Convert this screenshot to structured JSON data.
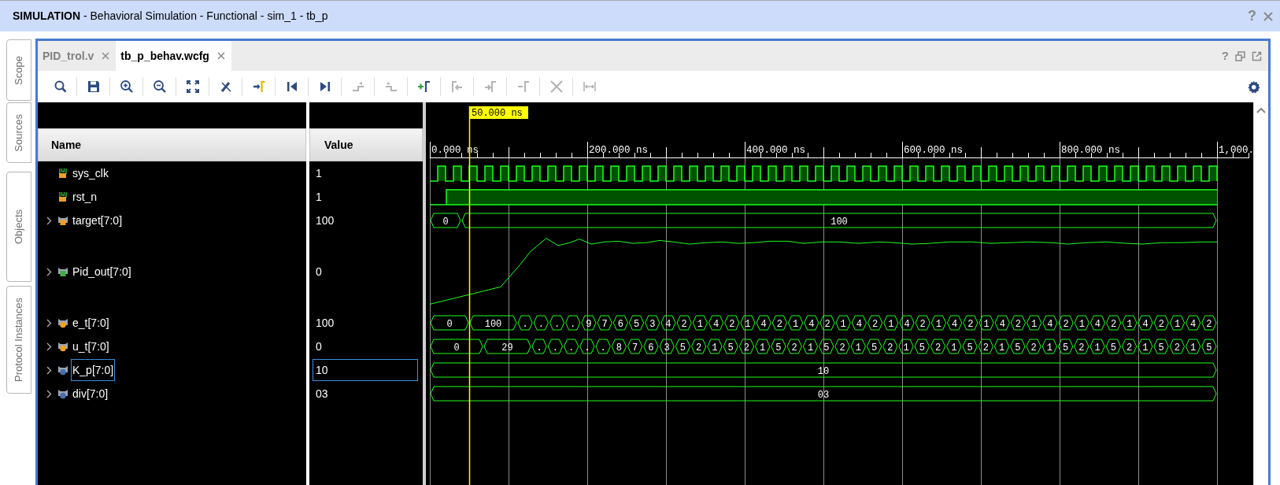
{
  "window": {
    "title": "**SIMULATION** - Behavioral Simulation - Functional - sim_1 - tb_p",
    "help": "?"
  },
  "side_tabs": [
    "Scope",
    "Sources",
    "Objects",
    "Protocol Instances"
  ],
  "tabs": [
    {
      "label": "PID_trol.v",
      "selected": false
    },
    {
      "label": "tb_p_behav.wcfg",
      "selected": true
    }
  ],
  "panel_help": "?",
  "toolbar": [
    {
      "disabled": false
    },
    {
      "disabled": false
    },
    {
      "disabled": false
    },
    {
      "disabled": false
    },
    {
      "disabled": false
    },
    {
      "disabled": false
    },
    {
      "disabled": false
    },
    {
      "disabled": false
    },
    {
      "disabled": false
    },
    {
      "disabled": true
    },
    {
      "disabled": true
    },
    {
      "disabled": false
    },
    {
      "disabled": true
    },
    {
      "disabled": true
    },
    {
      "disabled": true
    },
    {
      "disabled": true
    },
    {
      "disabled": true
    }
  ],
  "columns": [
    "Name",
    "Value"
  ],
  "signals": [
    {
      "name": "sys_clk",
      "value": "1",
      "kind": "clock",
      "selected": false
    },
    {
      "name": "rst_n",
      "value": "1",
      "kind": "bit",
      "selected": false
    },
    {
      "name": "target[7:0]",
      "value": "100",
      "kind": "bus_input",
      "selected": false,
      "segments": [
        "0",
        "100"
      ]
    },
    {
      "name": "Pid_out[7:0]",
      "value": "0",
      "kind": "analog_output",
      "selected": false
    },
    {
      "name": "e_t[7:0]",
      "value": "100",
      "kind": "bus_internal",
      "selected": false,
      "segments": [
        "0",
        "100",
        ".",
        ".",
        ".",
        ".",
        "9",
        "7",
        "6",
        "5",
        "3",
        "4",
        "2",
        "1",
        "4",
        "2",
        "1",
        "4",
        "2",
        "1",
        "4",
        "2",
        "1",
        "4",
        "2",
        "1",
        "4",
        "2",
        "1",
        "4",
        "2",
        "1",
        "4",
        "2",
        "1",
        "4",
        "2",
        "1",
        "4",
        "2",
        "1",
        "4",
        "2",
        "1",
        "4",
        "2"
      ]
    },
    {
      "name": "u_t[7:0]",
      "value": "0",
      "kind": "bus_internal",
      "selected": false,
      "segments": [
        "0",
        "29",
        ".",
        ".",
        ".",
        ".",
        ".",
        "8",
        "7",
        "6",
        "3",
        "5",
        "2",
        "1",
        "5",
        "2",
        "1",
        "5",
        "2",
        "1",
        "5",
        "2",
        "1",
        "5",
        "2",
        "1",
        "5",
        "2",
        "1",
        "5",
        "2",
        "1",
        "5",
        "2",
        "1",
        "5",
        "2",
        "1",
        "5",
        "2",
        "1",
        "5",
        "2",
        "1",
        "5"
      ]
    },
    {
      "name": "K_p[7:0]",
      "value": "10",
      "kind": "bus_constant",
      "selected": true,
      "segments": [
        "10"
      ]
    },
    {
      "name": "div[7:0]",
      "value": "03",
      "kind": "bus_constant",
      "selected": false,
      "segments": [
        "03"
      ]
    }
  ],
  "wave": {
    "cursor": "50.000 ns",
    "ruler": [
      "0.000 ns",
      "200.000 ns",
      "400.000 ns",
      "600.000 ns",
      "800.000 ns",
      "1,000."
    ]
  }
}
